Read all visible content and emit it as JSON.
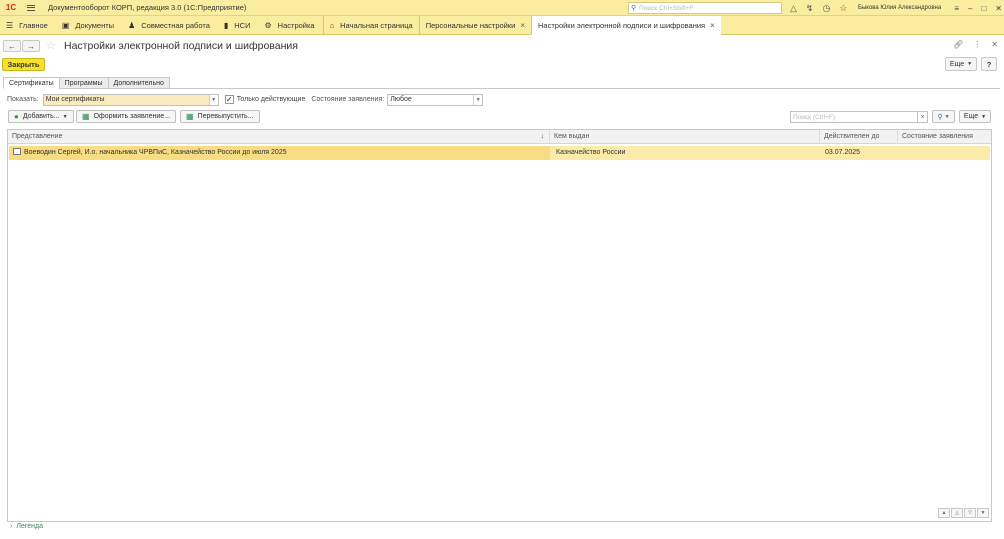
{
  "titlebar": {
    "app_title": "Документооборот КОРП, редакция 3.0  (1С:Предприятие)",
    "search_placeholder": "Поиск Ctrl+Shift+F",
    "user": "Быкова Юлия Александровна"
  },
  "sections": [
    {
      "label": "Главное",
      "icon": "menu-bars-icon"
    },
    {
      "label": "Документы",
      "icon": "folder-icon"
    },
    {
      "label": "Совместная работа",
      "icon": "people-icon"
    },
    {
      "label": "НСИ",
      "icon": "book-icon"
    },
    {
      "label": "Настройка",
      "icon": "gear-icon"
    }
  ],
  "open_tabs": [
    {
      "label": "Начальная страница",
      "icon": "home-icon"
    },
    {
      "label": "Персональные настройки",
      "closable": true
    },
    {
      "label": "Настройки электронной подписи и шифрования",
      "closable": true,
      "active": true
    }
  ],
  "form": {
    "title": "Настройки электронной подписи и шифрования",
    "close_label": "Закрыть",
    "more_label": "Еще",
    "help_label": "?"
  },
  "page_tabs": [
    "Сертификаты",
    "Программы",
    "Дополнительно"
  ],
  "filter": {
    "show_label": "Показать:",
    "show_value": "Мои сертификаты",
    "only_active_label": "Только действующие",
    "only_active_checked": true,
    "state_label": "Состояние заявления:",
    "state_value": "Любое"
  },
  "toolbar": {
    "add_label": "Добавить...",
    "apply_label": "Оформить заявление...",
    "reissue_label": "Перевыпустить...",
    "search_placeholder": "Поиск (Ctrl+F)",
    "more_label": "Еще"
  },
  "table": {
    "columns": [
      "Представление",
      "Кем выдан",
      "Действителен до",
      "Состояние заявления"
    ],
    "rows": [
      {
        "representation": "Воеводин Сергей, И.о. начальника ЧРВПиС, Казначейство России до июля 2025",
        "issued_by": "Казначейство России",
        "valid_until": "03.07.2025",
        "request_state": ""
      }
    ]
  },
  "legend_label": "Легенда",
  "colors": {
    "accent_yellow": "#f5e22c",
    "header_bg": "#fbeda0",
    "selected_row": "#fbeaa8",
    "logo_red": "#d8241c"
  }
}
